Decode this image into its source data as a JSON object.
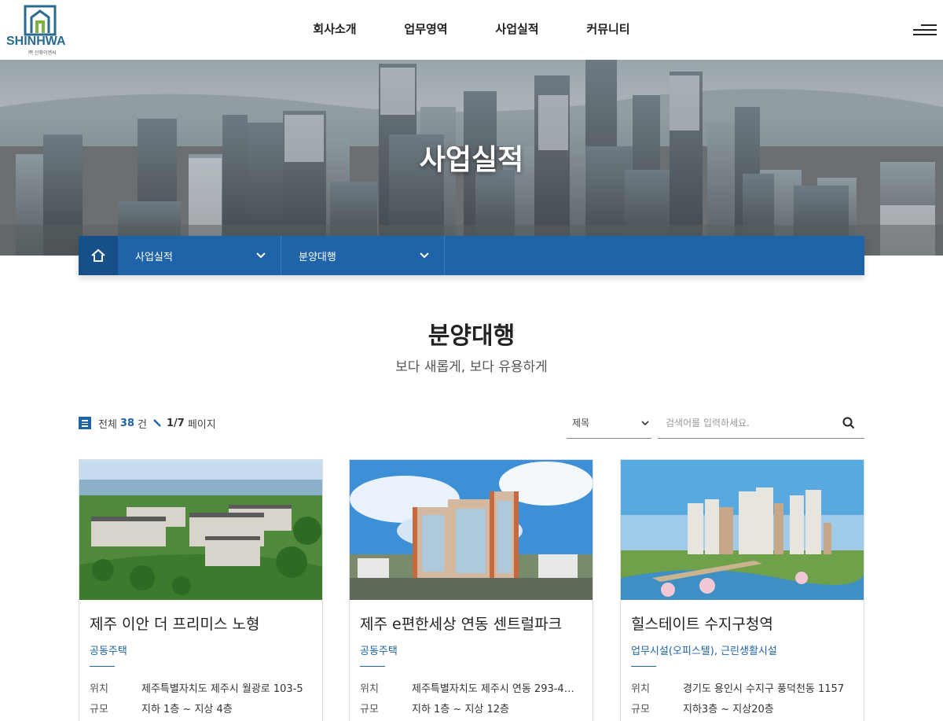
{
  "brand": {
    "logo_text": "SHINHWA",
    "logo_sub": "㈜ 신화이엔씨",
    "colors": {
      "primary": "#1f63a8",
      "primary_dark": "#174f89",
      "logo_blue": "#2a6a8e",
      "logo_green": "#7cb342"
    }
  },
  "nav": {
    "items": [
      {
        "label": "회사소개"
      },
      {
        "label": "업무영역"
      },
      {
        "label": "사업실적"
      },
      {
        "label": "커뮤니티"
      }
    ],
    "menu_icon": "hamburger-icon"
  },
  "hero": {
    "title": "사업실적"
  },
  "breadcrumb": {
    "home_icon": "home-icon",
    "level1": "사업실적",
    "level2": "분양대행"
  },
  "section": {
    "title": "분양대행",
    "subtitle": "보다 새롭게, 보다 유용하게"
  },
  "list_info": {
    "total_label": "전체",
    "total": "38",
    "unit": "건",
    "page": "1/7",
    "page_label": "페이지"
  },
  "search": {
    "filter_value": "제목",
    "placeholder": "검색어를 입력하세요.",
    "button_icon": "search-icon"
  },
  "cards": [
    {
      "title": "제주 이안 더 프리미스 노형",
      "category": "공동주택",
      "location_label": "위치",
      "location": "제주특별자치도 제주시 월광로 103-5",
      "scale_label": "규모",
      "scale": "지하 1층 ~ 지상 4층"
    },
    {
      "title": "제주 e편한세상 연동 센트럴파크",
      "category": "공동주택",
      "location_label": "위치",
      "location": "제주특별자치도 제주시 연동 293-4…",
      "scale_label": "규모",
      "scale": "지하 1층 ~ 지상 12층"
    },
    {
      "title": "힐스테이트 수지구청역",
      "category": "업무시설(오피스텔), 근린생활시설",
      "location_label": "위치",
      "location": "경기도 용인시 수지구 풍덕천동 1157",
      "scale_label": "규모",
      "scale": "지하3층 ~ 지상20층"
    }
  ]
}
